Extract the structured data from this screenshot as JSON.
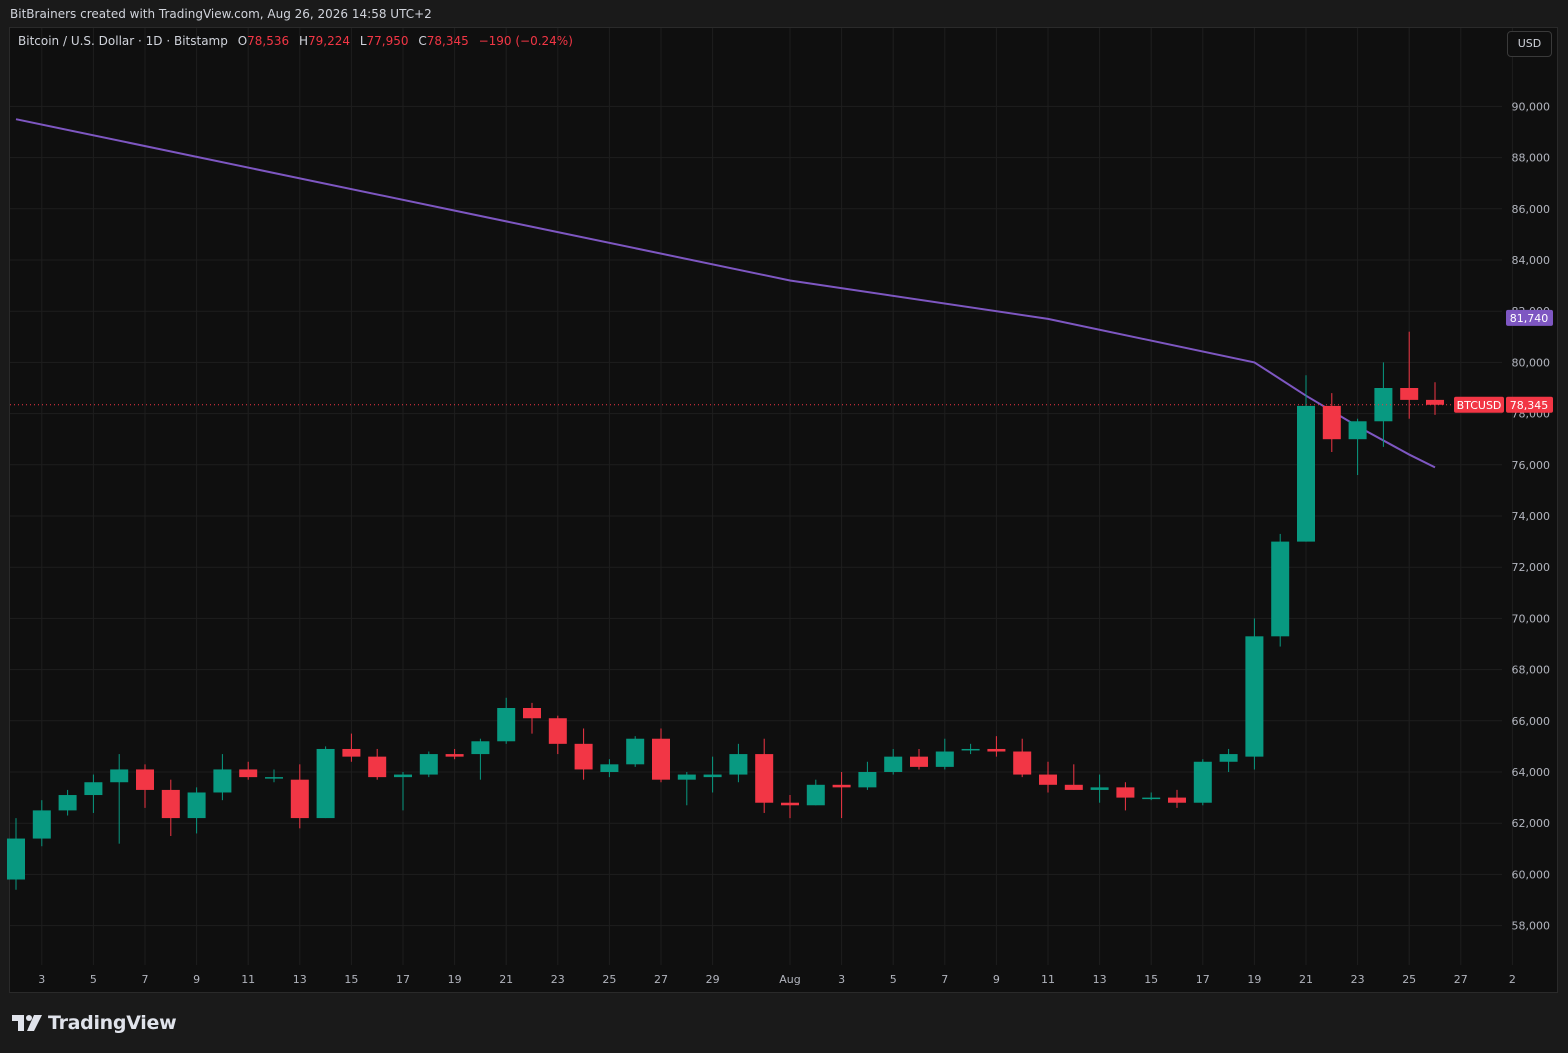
{
  "header": {
    "credit": "BitBrainers created with TradingView.com, Aug 26, 2026 14:58 UTC+2"
  },
  "legend": {
    "symbol": "Bitcoin / U.S. Dollar · 1D · Bitstamp",
    "open_key": "O",
    "open": "78,536",
    "high_key": "H",
    "high": "79,224",
    "low_key": "L",
    "low": "77,950",
    "close_key": "C",
    "close": "78,345",
    "change": "−190 (−0.24%)"
  },
  "currency_button": "USD",
  "footer": {
    "brand": "TradingView"
  },
  "colors": {
    "up": "#089981",
    "down": "#f23645",
    "ma": "#7e57c2",
    "background": "#0f0f0f",
    "grid": "#1e1e1e"
  },
  "chart_data": {
    "type": "candlestick",
    "symbol": "BTCUSD",
    "interval": "1D",
    "ylim": [
      57000,
      92000
    ],
    "yticks": [
      58000,
      60000,
      62000,
      64000,
      66000,
      68000,
      70000,
      72000,
      74000,
      76000,
      78000,
      80000,
      82000,
      84000,
      86000,
      88000,
      90000
    ],
    "ytick_labels": [
      "58,000",
      "60,000",
      "62,000",
      "64,000",
      "66,000",
      "68,000",
      "70,000",
      "72,000",
      "74,000",
      "76,000",
      "78,000",
      "80,000",
      "82,000",
      "84,000",
      "86,000",
      "88,000",
      "90,000"
    ],
    "xticks": [
      {
        "i": 1,
        "label": "3"
      },
      {
        "i": 3,
        "label": "5"
      },
      {
        "i": 5,
        "label": "7"
      },
      {
        "i": 7,
        "label": "9"
      },
      {
        "i": 9,
        "label": "11"
      },
      {
        "i": 11,
        "label": "13"
      },
      {
        "i": 13,
        "label": "15"
      },
      {
        "i": 15,
        "label": "17"
      },
      {
        "i": 17,
        "label": "19"
      },
      {
        "i": 19,
        "label": "21"
      },
      {
        "i": 21,
        "label": "23"
      },
      {
        "i": 23,
        "label": "25"
      },
      {
        "i": 25,
        "label": "27"
      },
      {
        "i": 27,
        "label": "29"
      },
      {
        "i": 30,
        "label": "Aug"
      },
      {
        "i": 32,
        "label": "3"
      },
      {
        "i": 34,
        "label": "5"
      },
      {
        "i": 36,
        "label": "7"
      },
      {
        "i": 38,
        "label": "9"
      },
      {
        "i": 40,
        "label": "11"
      },
      {
        "i": 42,
        "label": "13"
      },
      {
        "i": 44,
        "label": "15"
      },
      {
        "i": 46,
        "label": "17"
      },
      {
        "i": 48,
        "label": "19"
      },
      {
        "i": 50,
        "label": "21"
      },
      {
        "i": 52,
        "label": "23"
      },
      {
        "i": 54,
        "label": "25"
      },
      {
        "i": 56,
        "label": "27"
      },
      {
        "i": 58,
        "label": "2"
      }
    ],
    "candles": [
      {
        "o": 59800,
        "h": 62200,
        "l": 59400,
        "c": 61400
      },
      {
        "o": 61400,
        "h": 62900,
        "l": 61100,
        "c": 62500
      },
      {
        "o": 62500,
        "h": 63300,
        "l": 62300,
        "c": 63100
      },
      {
        "o": 63100,
        "h": 63900,
        "l": 62400,
        "c": 63600
      },
      {
        "o": 63600,
        "h": 64700,
        "l": 61200,
        "c": 64100
      },
      {
        "o": 64100,
        "h": 64300,
        "l": 62600,
        "c": 63300
      },
      {
        "o": 63300,
        "h": 63700,
        "l": 61500,
        "c": 62200
      },
      {
        "o": 62200,
        "h": 63400,
        "l": 61600,
        "c": 63200
      },
      {
        "o": 63200,
        "h": 64700,
        "l": 62900,
        "c": 64100
      },
      {
        "o": 64100,
        "h": 64400,
        "l": 63700,
        "c": 63800
      },
      {
        "o": 63800,
        "h": 64100,
        "l": 63600,
        "c": 63800
      },
      {
        "o": 63700,
        "h": 64300,
        "l": 61800,
        "c": 62200
      },
      {
        "o": 62200,
        "h": 65000,
        "l": 62200,
        "c": 64900
      },
      {
        "o": 64900,
        "h": 65500,
        "l": 64400,
        "c": 64600
      },
      {
        "o": 64600,
        "h": 64900,
        "l": 63700,
        "c": 63800
      },
      {
        "o": 63800,
        "h": 64000,
        "l": 62500,
        "c": 63900
      },
      {
        "o": 63900,
        "h": 64800,
        "l": 63800,
        "c": 64700
      },
      {
        "o": 64700,
        "h": 64900,
        "l": 64500,
        "c": 64600
      },
      {
        "o": 64700,
        "h": 65300,
        "l": 63700,
        "c": 65200
      },
      {
        "o": 65200,
        "h": 66900,
        "l": 65100,
        "c": 66500
      },
      {
        "o": 66500,
        "h": 66700,
        "l": 65500,
        "c": 66100
      },
      {
        "o": 66100,
        "h": 66200,
        "l": 64700,
        "c": 65100
      },
      {
        "o": 65100,
        "h": 65700,
        "l": 63700,
        "c": 64100
      },
      {
        "o": 64000,
        "h": 64500,
        "l": 63800,
        "c": 64300
      },
      {
        "o": 64300,
        "h": 65400,
        "l": 64200,
        "c": 65300
      },
      {
        "o": 65300,
        "h": 65700,
        "l": 63600,
        "c": 63700
      },
      {
        "o": 63700,
        "h": 64000,
        "l": 62700,
        "c": 63900
      },
      {
        "o": 63800,
        "h": 64600,
        "l": 63200,
        "c": 63900
      },
      {
        "o": 63900,
        "h": 65100,
        "l": 63600,
        "c": 64700
      },
      {
        "o": 64700,
        "h": 65300,
        "l": 62400,
        "c": 62800
      },
      {
        "o": 62800,
        "h": 63100,
        "l": 62200,
        "c": 62700
      },
      {
        "o": 62700,
        "h": 63700,
        "l": 62700,
        "c": 63500
      },
      {
        "o": 63500,
        "h": 64000,
        "l": 62200,
        "c": 63400
      },
      {
        "o": 63400,
        "h": 64400,
        "l": 63300,
        "c": 64000
      },
      {
        "o": 64000,
        "h": 64900,
        "l": 63900,
        "c": 64600
      },
      {
        "o": 64600,
        "h": 64900,
        "l": 64100,
        "c": 64200
      },
      {
        "o": 64200,
        "h": 65300,
        "l": 64100,
        "c": 64800
      },
      {
        "o": 64900,
        "h": 65100,
        "l": 64700,
        "c": 64900
      },
      {
        "o": 64900,
        "h": 65400,
        "l": 64600,
        "c": 64800
      },
      {
        "o": 64800,
        "h": 65300,
        "l": 63800,
        "c": 63900
      },
      {
        "o": 63900,
        "h": 64400,
        "l": 63200,
        "c": 63500
      },
      {
        "o": 63500,
        "h": 64300,
        "l": 63300,
        "c": 63300
      },
      {
        "o": 63300,
        "h": 63900,
        "l": 62800,
        "c": 63400
      },
      {
        "o": 63400,
        "h": 63600,
        "l": 62500,
        "c": 63000
      },
      {
        "o": 63000,
        "h": 63200,
        "l": 62900,
        "c": 63000
      },
      {
        "o": 63000,
        "h": 63300,
        "l": 62600,
        "c": 62800
      },
      {
        "o": 62800,
        "h": 64500,
        "l": 62700,
        "c": 64400
      },
      {
        "o": 64400,
        "h": 64900,
        "l": 64000,
        "c": 64700
      },
      {
        "o": 64600,
        "h": 70000,
        "l": 64100,
        "c": 69300
      },
      {
        "o": 69300,
        "h": 73300,
        "l": 68900,
        "c": 73000
      },
      {
        "o": 73000,
        "h": 79500,
        "l": 73000,
        "c": 78300
      },
      {
        "o": 78300,
        "h": 78800,
        "l": 76500,
        "c": 77000
      },
      {
        "o": 77000,
        "h": 77800,
        "l": 75600,
        "c": 77700
      },
      {
        "o": 77700,
        "h": 80000,
        "l": 76700,
        "c": 79000
      },
      {
        "o": 79000,
        "h": 81200,
        "l": 77800,
        "c": 78536
      },
      {
        "o": 78536,
        "h": 79224,
        "l": 77950,
        "c": 78345
      }
    ],
    "moving_average": {
      "color": "#7e57c2",
      "points": [
        [
          0,
          89500
        ],
        [
          10,
          87400
        ],
        [
          20,
          85300
        ],
        [
          30,
          83200
        ],
        [
          40,
          81700
        ],
        [
          48,
          80000
        ],
        [
          50,
          78700
        ],
        [
          52,
          77500
        ],
        [
          54,
          76400
        ],
        [
          55,
          75900
        ]
      ],
      "last_value": 81740,
      "last_value_label": "81,740"
    },
    "last_price": {
      "value": 78345,
      "label": "78,345",
      "symbol": "BTCUSD"
    }
  }
}
